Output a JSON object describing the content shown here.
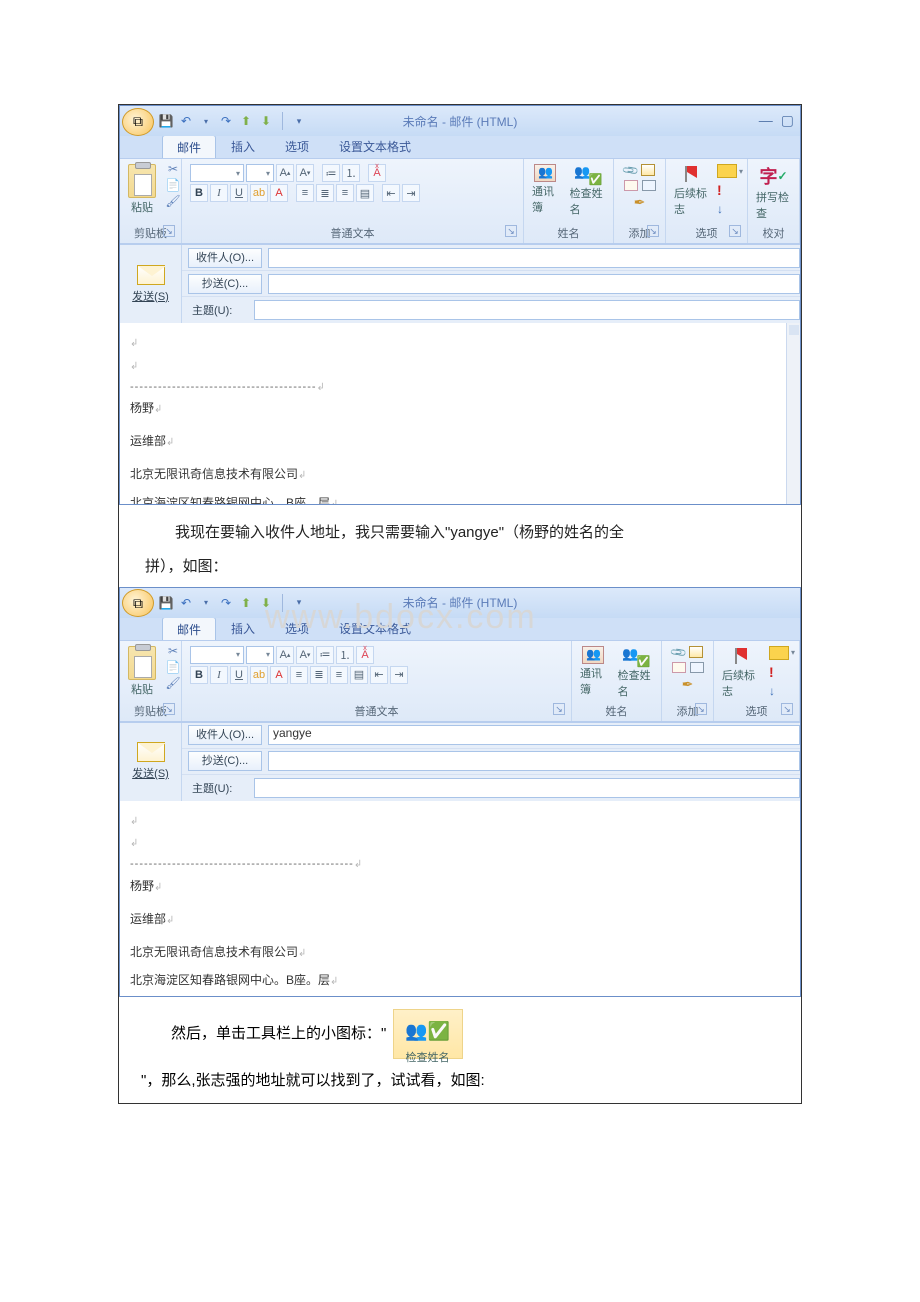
{
  "window": {
    "title": "未命名 - 邮件 (HTML)",
    "tabs": [
      "邮件",
      "插入",
      "选项",
      "设置文本格式"
    ],
    "ribbon_groups": {
      "clipboard": {
        "label": "剪贴板",
        "paste": "粘贴"
      },
      "basic_text": {
        "label": "普通文本"
      },
      "names": {
        "label": "姓名",
        "address_book": "通讯簿",
        "check_names": "检查姓名"
      },
      "include": {
        "label": "添加"
      },
      "options": {
        "label": "选项",
        "follow_up": "后续标志"
      },
      "proofing": {
        "label": "校对",
        "spell": "拼写检查"
      }
    },
    "compose": {
      "send": "发送(S)",
      "to_btn": "收件人(O)...",
      "cc_btn": "抄送(C)...",
      "subject_lbl": "主题(U):"
    },
    "signature": {
      "name": "杨野",
      "dept": "运维部",
      "company": "北京无限讯奇信息技术有限公司",
      "addr": "北京海淀区知春路银网中心。B座。层"
    }
  },
  "input_yangye": "yangye",
  "paragraphs": {
    "p1a": "　　我现在要输入收件人地址，我只需要输入\"yangye\"（杨野的姓名的全",
    "p1b": "拼），如图：",
    "p2a": "　　然后，单击工具栏上的小图标：\"",
    "p2c": "\"，那么,张志强的地址就可以找到了，试试看，如图:"
  },
  "watermark": "www.bdocx.com",
  "inline_icon_label": "检查姓名"
}
